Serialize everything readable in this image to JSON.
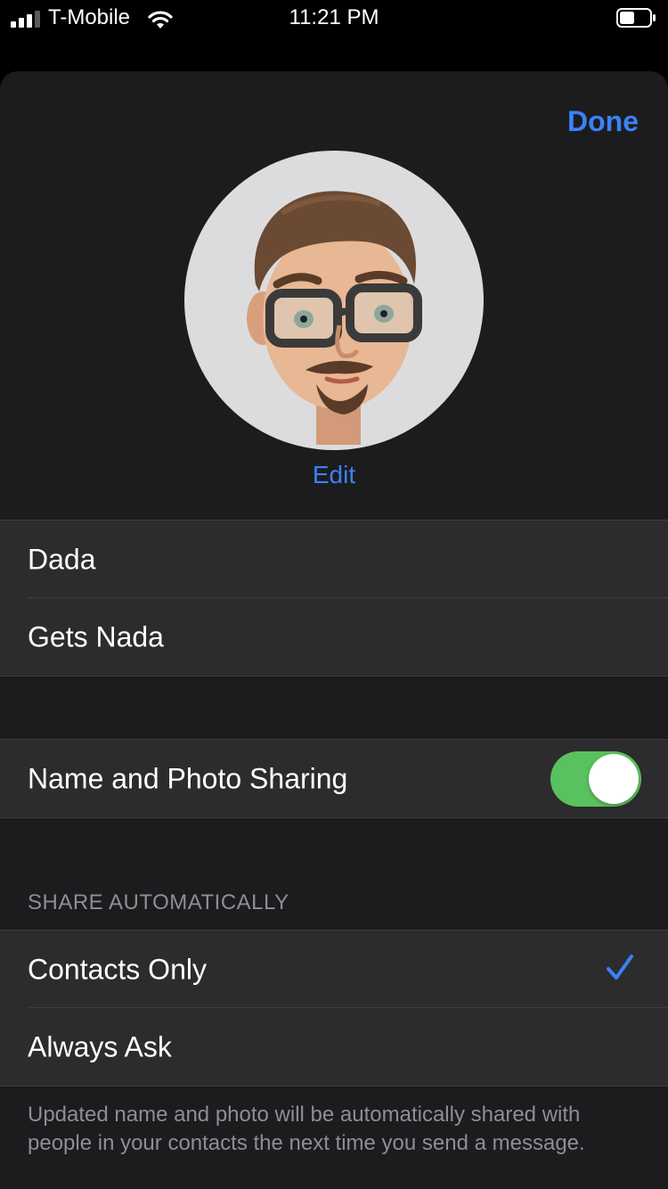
{
  "status_bar": {
    "carrier": "T-Mobile",
    "time": "11:21 PM",
    "icons": [
      "signal-icon",
      "wifi-icon",
      "battery-icon"
    ]
  },
  "header": {
    "done_label": "Done"
  },
  "profile": {
    "edit_label": "Edit",
    "avatar": "memoji-avatar"
  },
  "name_fields": {
    "first_name": "Dada",
    "last_name": "Gets Nada"
  },
  "sharing": {
    "label": "Name and Photo Sharing",
    "enabled": true
  },
  "share_automatically": {
    "header": "SHARE AUTOMATICALLY",
    "options": [
      {
        "label": "Contacts Only",
        "selected": true
      },
      {
        "label": "Always Ask",
        "selected": false
      }
    ],
    "footer": "Updated name and photo will be automatically shared with people in your contacts the next time you send a message."
  },
  "colors": {
    "accent": "#3a82f7",
    "toggle_on": "#5ac15f",
    "sheet_bg": "#1c1c1e",
    "cell_bg": "#2c2c2e",
    "secondary_text": "#8e8e93"
  }
}
